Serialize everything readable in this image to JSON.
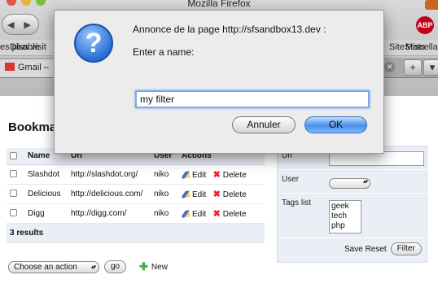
{
  "browser": {
    "window_title": "Mozilla Firefox",
    "back_glyph": "◀",
    "forward_glyph": "▶",
    "abp_label": "ABP",
    "bookmarks": [
      "es plus visit",
      "Disable",
      "SiteStats",
      "Miscella"
    ],
    "tab_label": "Gmail –",
    "tab_close": "✕",
    "new_tab": "+",
    "tab_menu": "▾"
  },
  "page": {
    "title": "Bookma",
    "table": {
      "headers": [
        "Name",
        "Url",
        "User",
        "Actions"
      ],
      "rows": [
        {
          "name": "Slashdot",
          "url": "http://slashdot.org/",
          "user": "niko",
          "edit": "Edit",
          "delete": "Delete"
        },
        {
          "name": "Delicious",
          "url": "http://delicious.com/",
          "user": "niko",
          "edit": "Edit",
          "delete": "Delete"
        },
        {
          "name": "Digg",
          "url": "http://digg.com/",
          "user": "niko",
          "edit": "Edit",
          "delete": "Delete"
        }
      ],
      "footer": "3 results"
    },
    "batch": {
      "select_value": "Choose an action",
      "go_label": "go",
      "new_label": "New"
    },
    "filter": {
      "url_label": "Url",
      "user_label": "User",
      "tags_label": "Tags list",
      "tags": [
        "geek",
        "tech",
        "php"
      ],
      "save_reset": "Save Reset",
      "filter_label": "Filter"
    }
  },
  "dialog": {
    "title": "Annonce de la page http://sfsandbox13.dev :",
    "prompt": "Enter a name:",
    "input_value": "my filter",
    "cancel_label": "Annuler",
    "ok_label": "OK"
  },
  "colors": {
    "ok_button": "#4a90e8",
    "table_header_bg": "#eaeef5",
    "abp_red": "#c4001c"
  }
}
